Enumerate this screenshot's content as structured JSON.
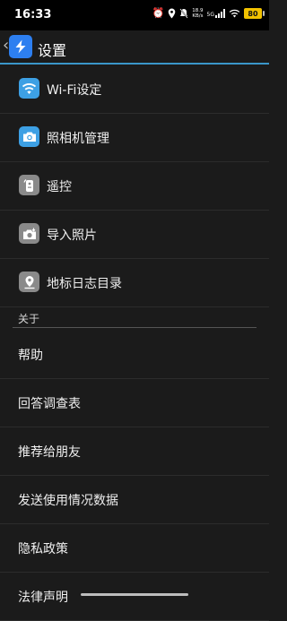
{
  "status_bar": {
    "time": "16:33",
    "net_speed_top": "18.9",
    "net_speed_bottom": "KB/s",
    "network_type": "5G",
    "battery": "80"
  },
  "app_bar": {
    "title": "设置",
    "back_icon": "chevron-left-icon",
    "logo_icon": "app-logo-icon"
  },
  "menu": {
    "items": [
      {
        "label": "Wi-Fi设定",
        "icon": "wifi-icon"
      },
      {
        "label": "照相机管理",
        "icon": "camera-icon"
      },
      {
        "label": "遥控",
        "icon": "remote-control-icon"
      },
      {
        "label": "导入照片",
        "icon": "import-photo-icon"
      },
      {
        "label": "地标日志目录",
        "icon": "location-pin-icon"
      }
    ]
  },
  "about": {
    "header": "关于",
    "items": [
      {
        "label": "帮助"
      },
      {
        "label": "回答调查表"
      },
      {
        "label": "推荐给朋友"
      },
      {
        "label": "发送使用情况数据"
      },
      {
        "label": "隐私政策"
      },
      {
        "label": "法律声明"
      }
    ]
  },
  "colors": {
    "accent": "#3a96c9",
    "icon_blue": "#3da0e4",
    "icon_gray": "#8a8a8a",
    "background": "#1b1b1b"
  }
}
